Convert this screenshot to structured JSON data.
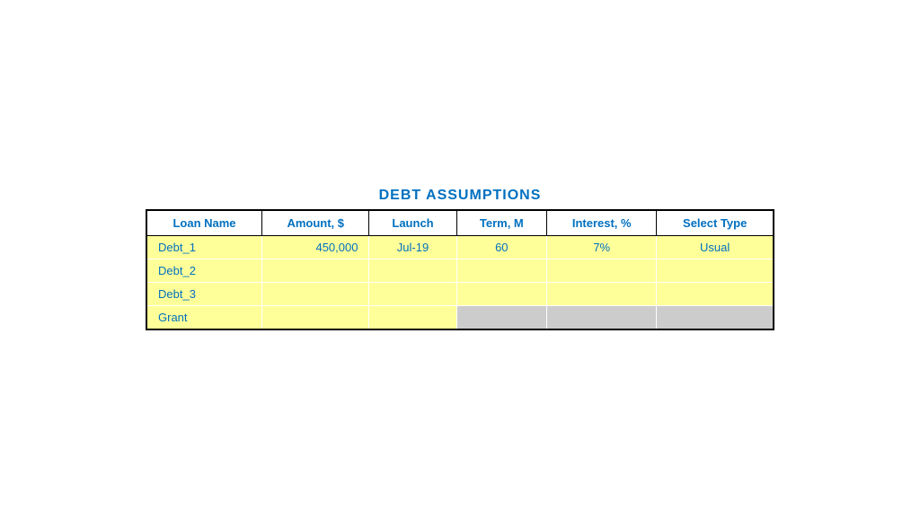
{
  "title": "DEBT ASSUMPTIONS",
  "columns": [
    {
      "id": "loan_name",
      "label": "Loan Name"
    },
    {
      "id": "amount",
      "label": "Amount, $"
    },
    {
      "id": "launch",
      "label": "Launch"
    },
    {
      "id": "term",
      "label": "Term, M"
    },
    {
      "id": "interest",
      "label": "Interest, %"
    },
    {
      "id": "select_type",
      "label": "Select Type"
    }
  ],
  "rows": [
    {
      "loan_name": "Debt_1",
      "amount": "450,000",
      "launch": "Jul-19",
      "term": "60",
      "interest": "7%",
      "select_type": "Usual",
      "row_class": "yellow-row",
      "gray_cells": []
    },
    {
      "loan_name": "Debt_2",
      "amount": "",
      "launch": "",
      "term": "",
      "interest": "",
      "select_type": "",
      "row_class": "yellow-row",
      "gray_cells": []
    },
    {
      "loan_name": "Debt_3",
      "amount": "",
      "launch": "",
      "term": "",
      "interest": "",
      "select_type": "",
      "row_class": "yellow-row",
      "gray_cells": []
    },
    {
      "loan_name": "Grant",
      "amount": "",
      "launch": "",
      "term": "",
      "interest": "",
      "select_type": "",
      "row_class": "yellow-row",
      "gray_cells": [
        "term",
        "interest",
        "select_type"
      ]
    }
  ]
}
